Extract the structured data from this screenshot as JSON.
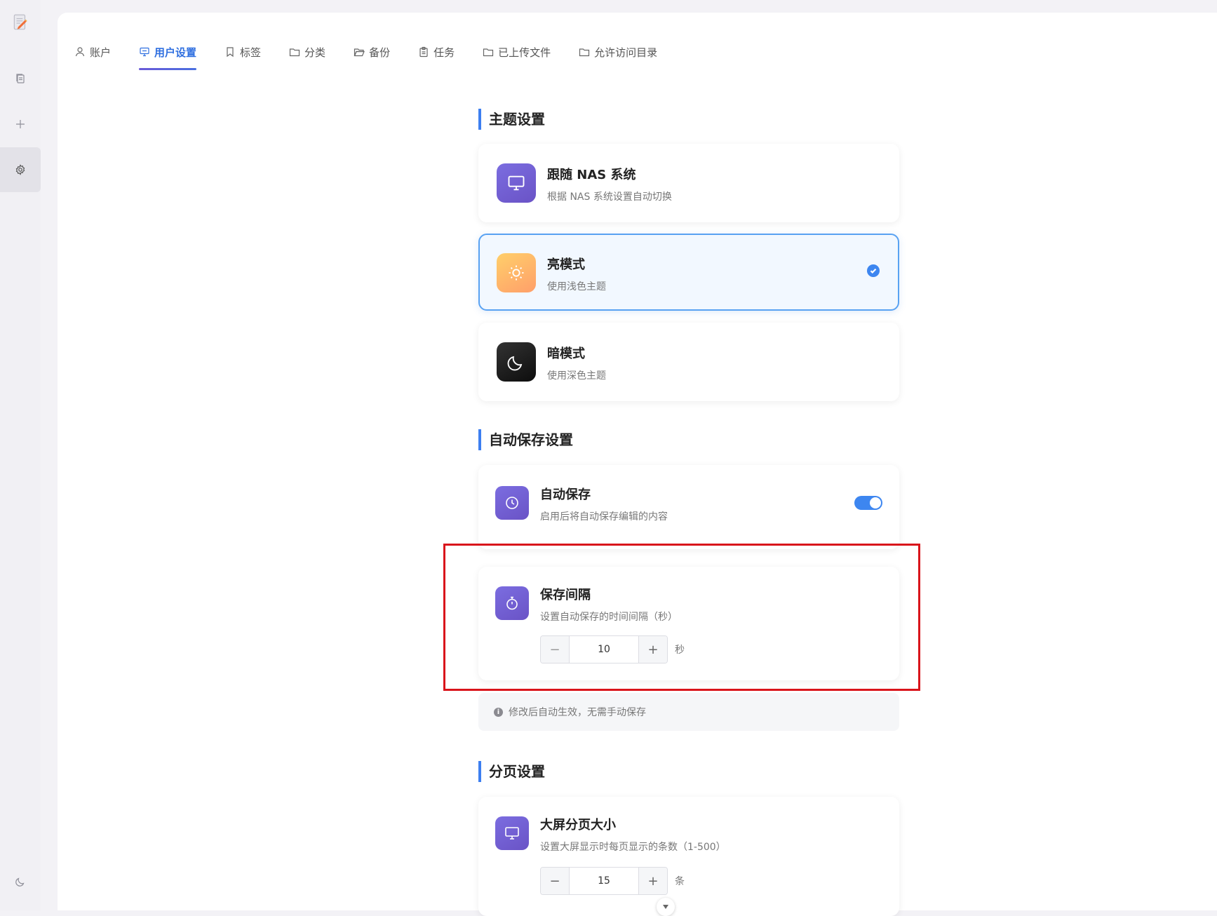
{
  "tabs": [
    {
      "label": "账户",
      "icon": "user-icon"
    },
    {
      "label": "用户设置",
      "icon": "monitor-settings-icon",
      "active": true
    },
    {
      "label": "标签",
      "icon": "bookmark-icon"
    },
    {
      "label": "分类",
      "icon": "folder-icon"
    },
    {
      "label": "备份",
      "icon": "folder-open-icon"
    },
    {
      "label": "任务",
      "icon": "clipboard-icon"
    },
    {
      "label": "已上传文件",
      "icon": "folder-icon"
    },
    {
      "label": "允许访问目录",
      "icon": "folder-icon"
    }
  ],
  "theme": {
    "section_title": "主题设置",
    "options": [
      {
        "title": "跟随 NAS 系统",
        "subtitle": "根据 NAS 系统设置自动切换",
        "icon": "monitor-icon",
        "selected": false
      },
      {
        "title": "亮模式",
        "subtitle": "使用浅色主题",
        "icon": "sun-icon",
        "selected": true
      },
      {
        "title": "暗模式",
        "subtitle": "使用深色主题",
        "icon": "moon-icon",
        "selected": false
      }
    ]
  },
  "autosave": {
    "section_title": "自动保存设置",
    "toggle": {
      "title": "自动保存",
      "subtitle": "启用后将自动保存编辑的内容",
      "enabled": true
    },
    "interval": {
      "title": "保存间隔",
      "subtitle": "设置自动保存的时间间隔（秒）",
      "value": "10",
      "unit": "秒"
    },
    "note": "修改后自动生效，无需手动保存"
  },
  "pagination": {
    "section_title": "分页设置",
    "large_screen": {
      "title": "大屏分页大小",
      "subtitle": "设置大屏显示时每页显示的条数（1-500）",
      "value": "15",
      "unit": "条"
    }
  },
  "colors": {
    "accent": "#3d86f0",
    "highlight_box": "#d9141b"
  }
}
